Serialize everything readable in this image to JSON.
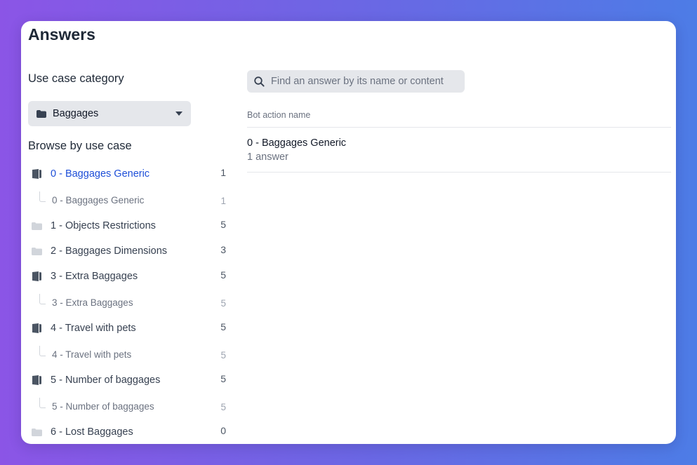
{
  "page": {
    "title": "Answers"
  },
  "sidebar": {
    "category_label": "Use case category",
    "category_select": {
      "selected": "Baggages",
      "icon": "folder-icon"
    },
    "browse_label": "Browse by use case",
    "items": [
      {
        "label": "0 - Baggages Generic",
        "count": "1",
        "icon": "book-icon",
        "active": true,
        "sub": false
      },
      {
        "label": "0 - Baggages Generic",
        "count": "1",
        "icon": "tree-connector",
        "active": false,
        "sub": true
      },
      {
        "label": "1 - Objects Restrictions",
        "count": "5",
        "icon": "folder-icon",
        "active": false,
        "sub": false
      },
      {
        "label": "2 - Baggages Dimensions",
        "count": "3",
        "icon": "folder-icon",
        "active": false,
        "sub": false
      },
      {
        "label": "3 - Extra Baggages",
        "count": "5",
        "icon": "book-icon",
        "active": false,
        "sub": false
      },
      {
        "label": "3 - Extra Baggages",
        "count": "5",
        "icon": "tree-connector",
        "active": false,
        "sub": true
      },
      {
        "label": "4 - Travel with pets",
        "count": "5",
        "icon": "book-icon",
        "active": false,
        "sub": false
      },
      {
        "label": "4 - Travel with pets",
        "count": "5",
        "icon": "tree-connector",
        "active": false,
        "sub": true
      },
      {
        "label": "5 - Number of baggages",
        "count": "5",
        "icon": "book-icon",
        "active": false,
        "sub": false
      },
      {
        "label": "5 - Number of baggages",
        "count": "5",
        "icon": "tree-connector",
        "active": false,
        "sub": true
      },
      {
        "label": "6 - Lost Baggages",
        "count": "0",
        "icon": "folder-icon",
        "active": false,
        "sub": false
      }
    ]
  },
  "main": {
    "search": {
      "placeholder": "Find an answer by its name or content",
      "value": ""
    },
    "column_header": "Bot action name",
    "answers": [
      {
        "name": "0 - Baggages Generic",
        "count": "1 answer"
      }
    ]
  },
  "colors": {
    "active": "#1d4ed8",
    "icon_dark": "#4b5563",
    "icon_light": "#d1d5db"
  }
}
